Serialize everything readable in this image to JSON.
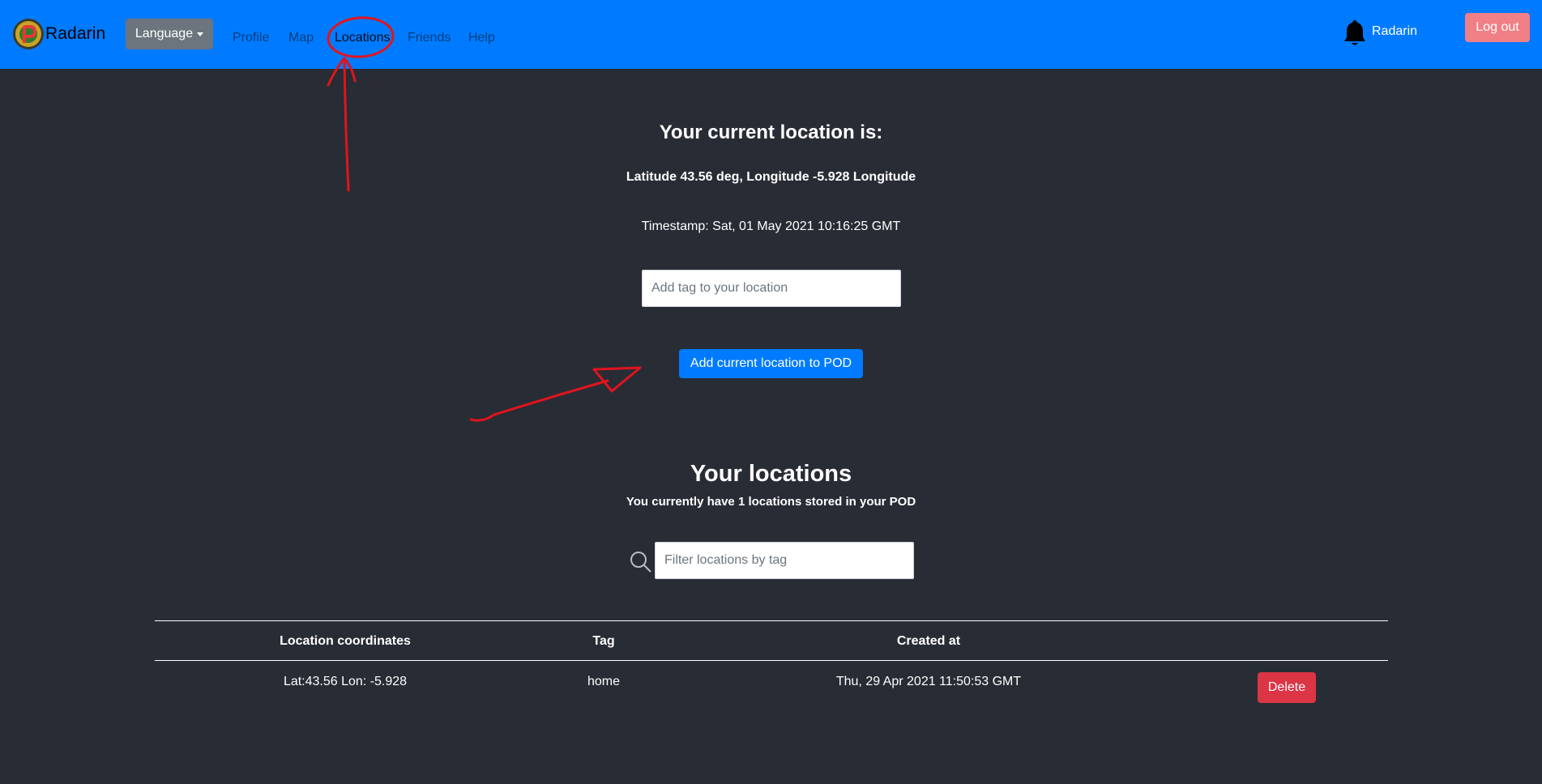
{
  "navbar": {
    "brand": "Radarin",
    "language_label": "Language",
    "links": [
      "Profile",
      "Map",
      "Locations",
      "Friends",
      "Help"
    ],
    "active_link": "Locations",
    "user": "Radarin",
    "logout_label": "Log out",
    "color": "#007bff"
  },
  "current": {
    "heading": "Your current location is:",
    "coordinates": "Latitude 43.56 deg, Longitude -5.928 Longitude",
    "timestamp": "Timestamp: Sat, 01 May 2021 10:16:25 GMT",
    "tag_placeholder": "Add tag to your location",
    "add_button": "Add current location to POD"
  },
  "locations": {
    "heading": "Your locations",
    "count_text": "You currently have 1 locations stored in your POD",
    "filter_placeholder": "Filter locations by tag",
    "columns": [
      "Location coordinates",
      "Tag",
      "Created at"
    ],
    "rows": [
      {
        "coordinates": "Lat:43.56 Lon: -5.928",
        "tag": "home",
        "created_at": "Thu, 29 Apr 2021 11:50:53 GMT",
        "delete_label": "Delete"
      }
    ]
  },
  "icons": {
    "logo": "radarin-logo-icon",
    "language_dropdown": "caret-down-icon",
    "notifications": "bell-icon",
    "search": "search-icon"
  },
  "colors": {
    "background": "#282c34",
    "primary": "#007bff",
    "secondary": "#6c757d",
    "danger": "#dc3545",
    "logout": "#f07f86",
    "annotation": "#e0141e"
  }
}
